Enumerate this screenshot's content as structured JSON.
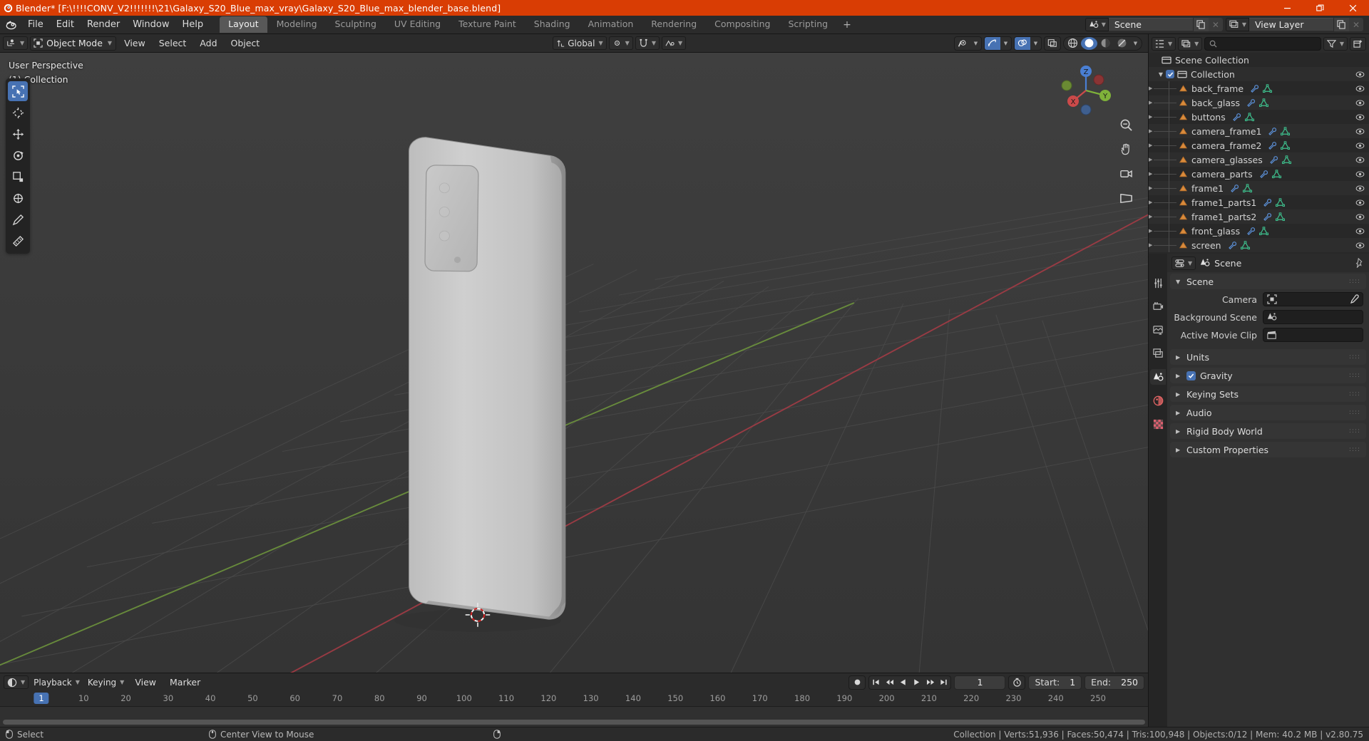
{
  "titlebar": {
    "title": "Blender* [F:\\!!!!CONV_V2!!!!!!!\\21\\Galaxy_S20_Blue_max_vray\\Galaxy_S20_Blue_max_blender_base.blend]",
    "minimize": "—",
    "restore": "❐",
    "close": "✕",
    "accent": "#d93d04"
  },
  "topbar": {
    "menus": [
      "File",
      "Edit",
      "Render",
      "Window",
      "Help"
    ],
    "workspaces": [
      {
        "label": "Layout",
        "active": true
      },
      {
        "label": "Modeling",
        "active": false
      },
      {
        "label": "Sculpting",
        "active": false
      },
      {
        "label": "UV Editing",
        "active": false
      },
      {
        "label": "Texture Paint",
        "active": false
      },
      {
        "label": "Shading",
        "active": false
      },
      {
        "label": "Animation",
        "active": false
      },
      {
        "label": "Rendering",
        "active": false
      },
      {
        "label": "Compositing",
        "active": false
      },
      {
        "label": "Scripting",
        "active": false
      }
    ],
    "add_workspace": "+",
    "scene": {
      "name": "Scene",
      "close": "✕"
    },
    "view_layer": {
      "name": "View Layer",
      "close": "✕"
    }
  },
  "viewport_header": {
    "mode": "Object Mode",
    "menus": [
      "View",
      "Select",
      "Add",
      "Object"
    ],
    "transform_orientation": "Global"
  },
  "viewport": {
    "perspective_label": "User Perspective",
    "collection_label": "(1) Collection",
    "gizmo_axes": {
      "x": "X",
      "y": "Y",
      "z": "Z"
    },
    "background": "#393939"
  },
  "outliner": {
    "search_placeholder": "",
    "scene_collection": "Scene Collection",
    "collection": "Collection",
    "items": [
      {
        "name": "back_frame"
      },
      {
        "name": "back_glass"
      },
      {
        "name": "buttons"
      },
      {
        "name": "camera_frame1"
      },
      {
        "name": "camera_frame2"
      },
      {
        "name": "camera_glasses"
      },
      {
        "name": "camera_parts"
      },
      {
        "name": "frame1"
      },
      {
        "name": "frame1_parts1"
      },
      {
        "name": "frame1_parts2"
      },
      {
        "name": "front_glass"
      },
      {
        "name": "screen"
      }
    ]
  },
  "properties": {
    "breadcrumb": "Scene",
    "panel_title": "Scene",
    "rows": [
      {
        "label": "Camera",
        "value": ""
      },
      {
        "label": "Background Scene",
        "value": ""
      },
      {
        "label": "Active Movie Clip",
        "value": ""
      }
    ],
    "sections": [
      {
        "label": "Units",
        "checkbox": false
      },
      {
        "label": "Gravity",
        "checkbox": true
      },
      {
        "label": "Keying Sets",
        "checkbox": false
      },
      {
        "label": "Audio",
        "checkbox": false
      },
      {
        "label": "Rigid Body World",
        "checkbox": false
      },
      {
        "label": "Custom Properties",
        "checkbox": false
      }
    ]
  },
  "timeline": {
    "menus": [
      "Playback",
      "Keying",
      "View",
      "Marker"
    ],
    "current_frame": "1",
    "start_label": "Start:",
    "start_value": "1",
    "end_label": "End:",
    "end_value": "250",
    "playhead_label": "1",
    "ticks": [
      "10",
      "20",
      "30",
      "40",
      "50",
      "60",
      "70",
      "80",
      "90",
      "100",
      "110",
      "120",
      "130",
      "140",
      "150",
      "160",
      "170",
      "180",
      "190",
      "200",
      "210",
      "220",
      "230",
      "240",
      "250"
    ]
  },
  "statusbar": {
    "select": "Select",
    "center_view": "Center View to Mouse",
    "stats": "Collection | Verts:51,936 | Faces:50,474 | Tris:100,948 | Objects:0/12 | Mem: 40.2 MB | v2.80.75"
  }
}
